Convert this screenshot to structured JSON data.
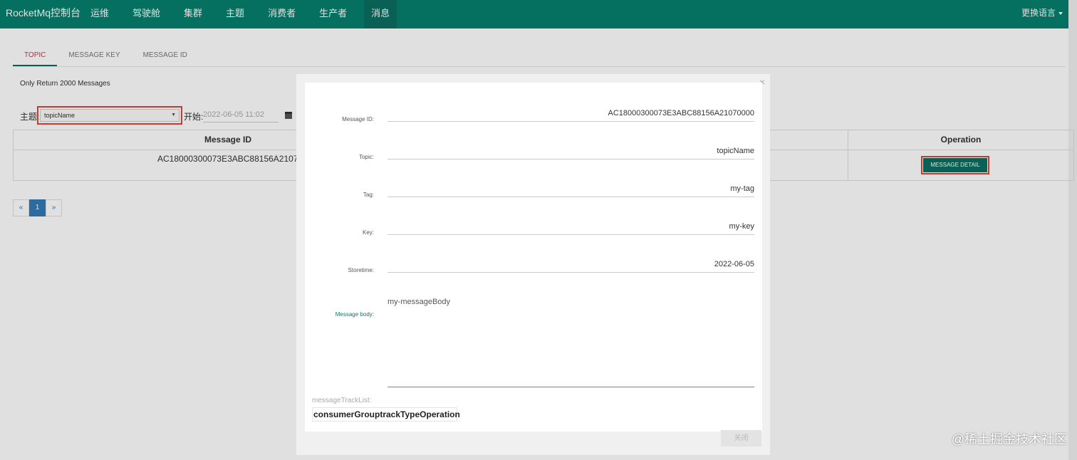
{
  "navbar": {
    "brand": "RocketMq控制台",
    "items": [
      "运维",
      "驾驶舱",
      "集群",
      "主题",
      "消费者",
      "生产者",
      "消息"
    ],
    "active_index": 6,
    "language": "更换语言"
  },
  "tabs": [
    {
      "label": "TOPIC",
      "active": true
    },
    {
      "label": "MESSAGE KEY",
      "active": false
    },
    {
      "label": "MESSAGE ID",
      "active": false
    }
  ],
  "notice": "Only Return 2000 Messages",
  "filter": {
    "topic_label": "主题:",
    "topic_value": "topicName",
    "start_label": "开始:",
    "start_value": "2022-06-05 11:02"
  },
  "table": {
    "headers": {
      "message_id": "Message ID",
      "operation": "Operation"
    },
    "rows": [
      {
        "message_id": "AC18000300073E3ABC88156A21070000",
        "operation_label": "MESSAGE DETAIL"
      }
    ]
  },
  "pagination": {
    "prev": "«",
    "current": "1",
    "next": "»"
  },
  "modal": {
    "close_x": "×",
    "fields": [
      {
        "label": "Message ID:",
        "value": "AC18000300073E3ABC88156A21070000"
      },
      {
        "label": "Topic:",
        "value": "topicName"
      },
      {
        "label": "Tag:",
        "value": "my-tag"
      },
      {
        "label": "Key:",
        "value": "my-key"
      },
      {
        "label": "Storetime:",
        "value": "2022-06-05"
      }
    ],
    "body_label": "Message body:",
    "body_value": "my-messageBody",
    "track_label": "messageTrackList:",
    "track_header": "consumerGrouptrackTypeOperation",
    "close_button": "关闭"
  },
  "watermark": "@稀土掘金技术社区",
  "colors": {
    "navbar": "#06806e",
    "accent": "#0a6f60",
    "highlight": "#e0443a",
    "active_tab": "#d9324f"
  }
}
